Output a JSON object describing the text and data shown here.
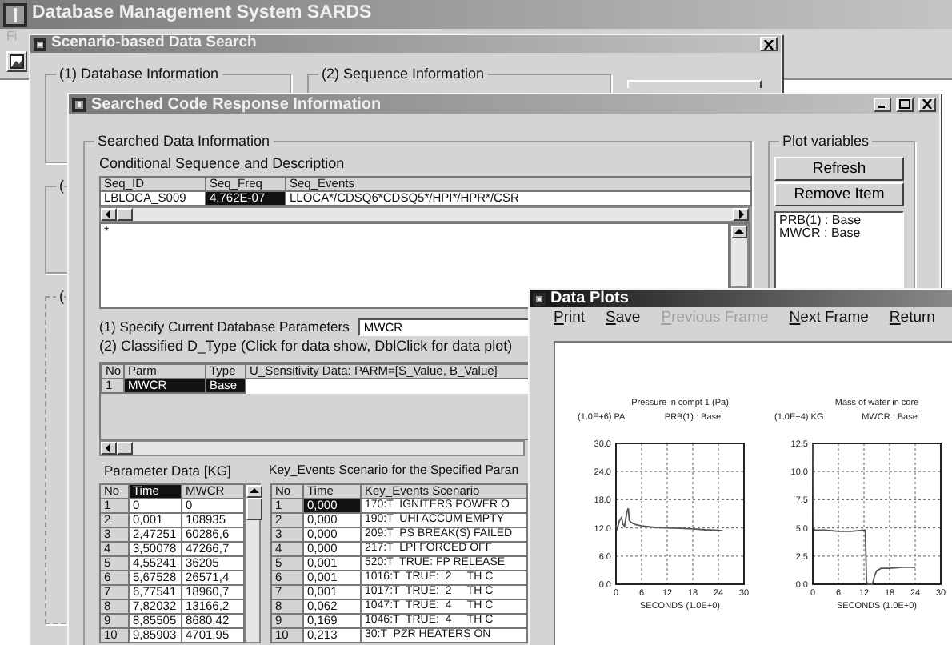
{
  "main_window": {
    "title": "Database Management System SARDS",
    "menu": [
      "Fi"
    ]
  },
  "search_window": {
    "title": "Scenario-based Data Search",
    "groups": [
      "(1) Database Information",
      "(2) Sequence Information"
    ],
    "side_groups": [
      "(",
      "("
    ]
  },
  "code_window": {
    "title": "Searched Code Response Information",
    "group_title": "Searched Data Information",
    "sequence_label": "Conditional Sequence and Description",
    "sequence_table": {
      "columns": [
        "Seq_ID",
        "Seq_Freq",
        "Seq_Events"
      ],
      "rows": [
        {
          "cells": [
            {
              "text": "LBLOCA_S009",
              "selected": false
            },
            {
              "text": "4,762E-07",
              "selected": true
            },
            {
              "text": "LLOCA*/CDSQ6*CDSQ5*/HPI*/HPR*/CSR",
              "selected": false
            }
          ]
        }
      ]
    },
    "description": "*",
    "param_label": "(1) Specify Current Database Parameters",
    "param_value": "MWCR",
    "dtype_label": "(2) Classified D_Type (Click for data show, DblClick for data plot)",
    "dtype_table": {
      "columns": [
        "No",
        "Parm",
        "Type",
        "U_Sensitivity Data: PARM=[S_Value, B_Value]"
      ],
      "rows": [
        {
          "cells": [
            "1",
            "MWCR",
            "Base"
          ],
          "selected": true
        }
      ]
    },
    "parameter_data": {
      "title": "Parameter Data [KG]",
      "columns": [
        {
          "label": "No",
          "selected": false
        },
        {
          "label": "Time",
          "selected": true
        },
        {
          "label": "MWCR",
          "selected": false
        }
      ],
      "rows": [
        [
          "1",
          "0",
          "0"
        ],
        [
          "2",
          "0,001",
          "108935"
        ],
        [
          "3",
          "2,47251",
          "60286,6"
        ],
        [
          "4",
          "3,50078",
          "47266,7"
        ],
        [
          "5",
          "4,55241",
          "36205"
        ],
        [
          "6",
          "5,67528",
          "26571,4"
        ],
        [
          "7",
          "6,77541",
          "18960,7"
        ],
        [
          "8",
          "7,82032",
          "13166,2"
        ],
        [
          "9",
          "8,85505",
          "8680,42"
        ],
        [
          "10",
          "9,85903",
          "4701,95"
        ]
      ]
    },
    "key_events": {
      "title": "Key_Events Scenario for the Specified Paran",
      "columns": [
        "No",
        "Time",
        "Key_Events Scenario"
      ],
      "rows": [
        {
          "no": "1",
          "time": "0,000",
          "event": "170:T  IGNITERS POWER O",
          "selected": true
        },
        {
          "no": "2",
          "time": "0,000",
          "event": "190:T  UHI ACCUM EMPTY",
          "selected": false
        },
        {
          "no": "3",
          "time": "0,000",
          "event": "209:T  PS BREAK(S) FAILED",
          "selected": false
        },
        {
          "no": "4",
          "time": "0,000",
          "event": "217:T  LPI FORCED OFF",
          "selected": false
        },
        {
          "no": "5",
          "time": "0,001",
          "event": "520:T  TRUE: FP RELEASE",
          "selected": false
        },
        {
          "no": "6",
          "time": "0,001",
          "event": "1016:T  TRUE:  2     TH C",
          "selected": false
        },
        {
          "no": "7",
          "time": "0,001",
          "event": "1017:T  TRUE:  2     TH C",
          "selected": false
        },
        {
          "no": "8",
          "time": "0,062",
          "event": "1047:T  TRUE:  4     TH C",
          "selected": false
        },
        {
          "no": "9",
          "time": "0,169",
          "event": "1046:T  TRUE:  4     TH C",
          "selected": false
        },
        {
          "no": "10",
          "time": "0,213",
          "event": "30:T  PZR HEATERS ON",
          "selected": false
        }
      ]
    },
    "plot_variables": {
      "title": "Plot variables",
      "buttons": [
        "Refresh",
        "Remove Item"
      ],
      "items": [
        "PRB(1) : Base",
        "MWCR : Base"
      ]
    }
  },
  "plots_window": {
    "title": "Data Plots",
    "menu": [
      {
        "label": "Print",
        "disabled": false
      },
      {
        "label": "Save",
        "disabled": false
      },
      {
        "label": "Previous Frame",
        "disabled": true
      },
      {
        "label": "Next Frame",
        "disabled": false
      },
      {
        "label": "Return",
        "disabled": false
      }
    ],
    "charts": [
      {
        "chart_data": {
          "type": "line",
          "grid": true,
          "title": "Pressure in compt 1 (Pa)",
          "xlabel": "SECONDS (1.0E+0)",
          "ylabel": "(1.0E+6) PA",
          "xlim": [
            0,
            30
          ],
          "ylim": [
            0,
            30
          ],
          "xticks": [
            0,
            6,
            12,
            18,
            24,
            30
          ],
          "yticks": [
            {
              "value": 0,
              "label": "0.0"
            },
            {
              "value": 6,
              "label": "6.0"
            },
            {
              "value": 12,
              "label": "12.0"
            },
            {
              "value": 18,
              "label": "18.0"
            },
            {
              "value": 24,
              "label": "24.0"
            },
            {
              "value": 30,
              "label": "30.0"
            }
          ],
          "x": [
            0,
            0.3,
            0.8,
            1.3,
            1.6,
            2,
            2.6,
            2.9,
            3.1,
            3.5,
            4.5,
            6,
            9,
            12,
            15,
            18,
            21,
            24,
            25
          ],
          "series": [
            {
              "name": "PRB(1) : Base",
              "color": "#555555",
              "values": [
                12.5,
                11.8,
                13.5,
                14.2,
                12.8,
                12.3,
                15.5,
                16.2,
                13.6,
                13.2,
                12.7,
                12.4,
                12.1,
                12.0,
                11.9,
                11.8,
                11.6,
                11.5,
                11.4
              ]
            }
          ]
        }
      },
      {
        "chart_data": {
          "type": "line",
          "grid": true,
          "title": "Mass of water in core",
          "xlabel": "SECONDS (1.0E+0)",
          "ylabel": "(1.0E+4) KG",
          "xlim": [
            0,
            30
          ],
          "ylim": [
            0,
            12.5
          ],
          "xticks": [
            0,
            6,
            12,
            18,
            24,
            30
          ],
          "yticks": [
            {
              "value": 0,
              "label": "0.0"
            },
            {
              "value": 2.5,
              "label": "2.5"
            },
            {
              "value": 5,
              "label": "5.0"
            },
            {
              "value": 7.5,
              "label": "7.5"
            },
            {
              "value": 10,
              "label": "10.0"
            },
            {
              "value": 12.5,
              "label": "12.5"
            }
          ],
          "x": [
            0,
            0.2,
            0.4,
            3,
            6,
            9,
            12,
            12.3,
            12.6,
            13,
            13.5,
            14,
            14.5,
            15,
            16,
            18,
            21,
            24
          ],
          "series": [
            {
              "name": "MWCR : Base",
              "color": "#555555",
              "values": [
                12.5,
                5.0,
                4.8,
                4.8,
                4.7,
                4.7,
                4.8,
                4.8,
                0.2,
                0,
                0,
                0,
                0.8,
                1.2,
                1.4,
                1.4,
                1.5,
                1.5
              ]
            }
          ]
        }
      }
    ]
  }
}
